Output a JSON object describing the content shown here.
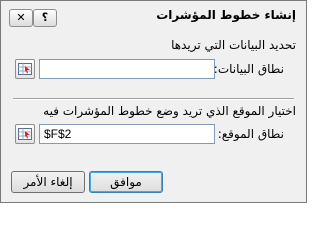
{
  "dialog": {
    "title": "إنشاء خطوط المؤشرات",
    "help_glyph": "؟",
    "close_glyph": "✕"
  },
  "data_section": {
    "heading": "تحديد البيانات التي تريدها",
    "range_label": "نطاق البيانات:",
    "range_value": ""
  },
  "location_section": {
    "heading": "اختيار الموقع الذي تريد وضع خطوط المؤشرات فيه",
    "range_label": "نطاق الموقع:",
    "range_value": "$F$2"
  },
  "buttons": {
    "ok": "موافق",
    "cancel": "إلغاء الأمر"
  }
}
